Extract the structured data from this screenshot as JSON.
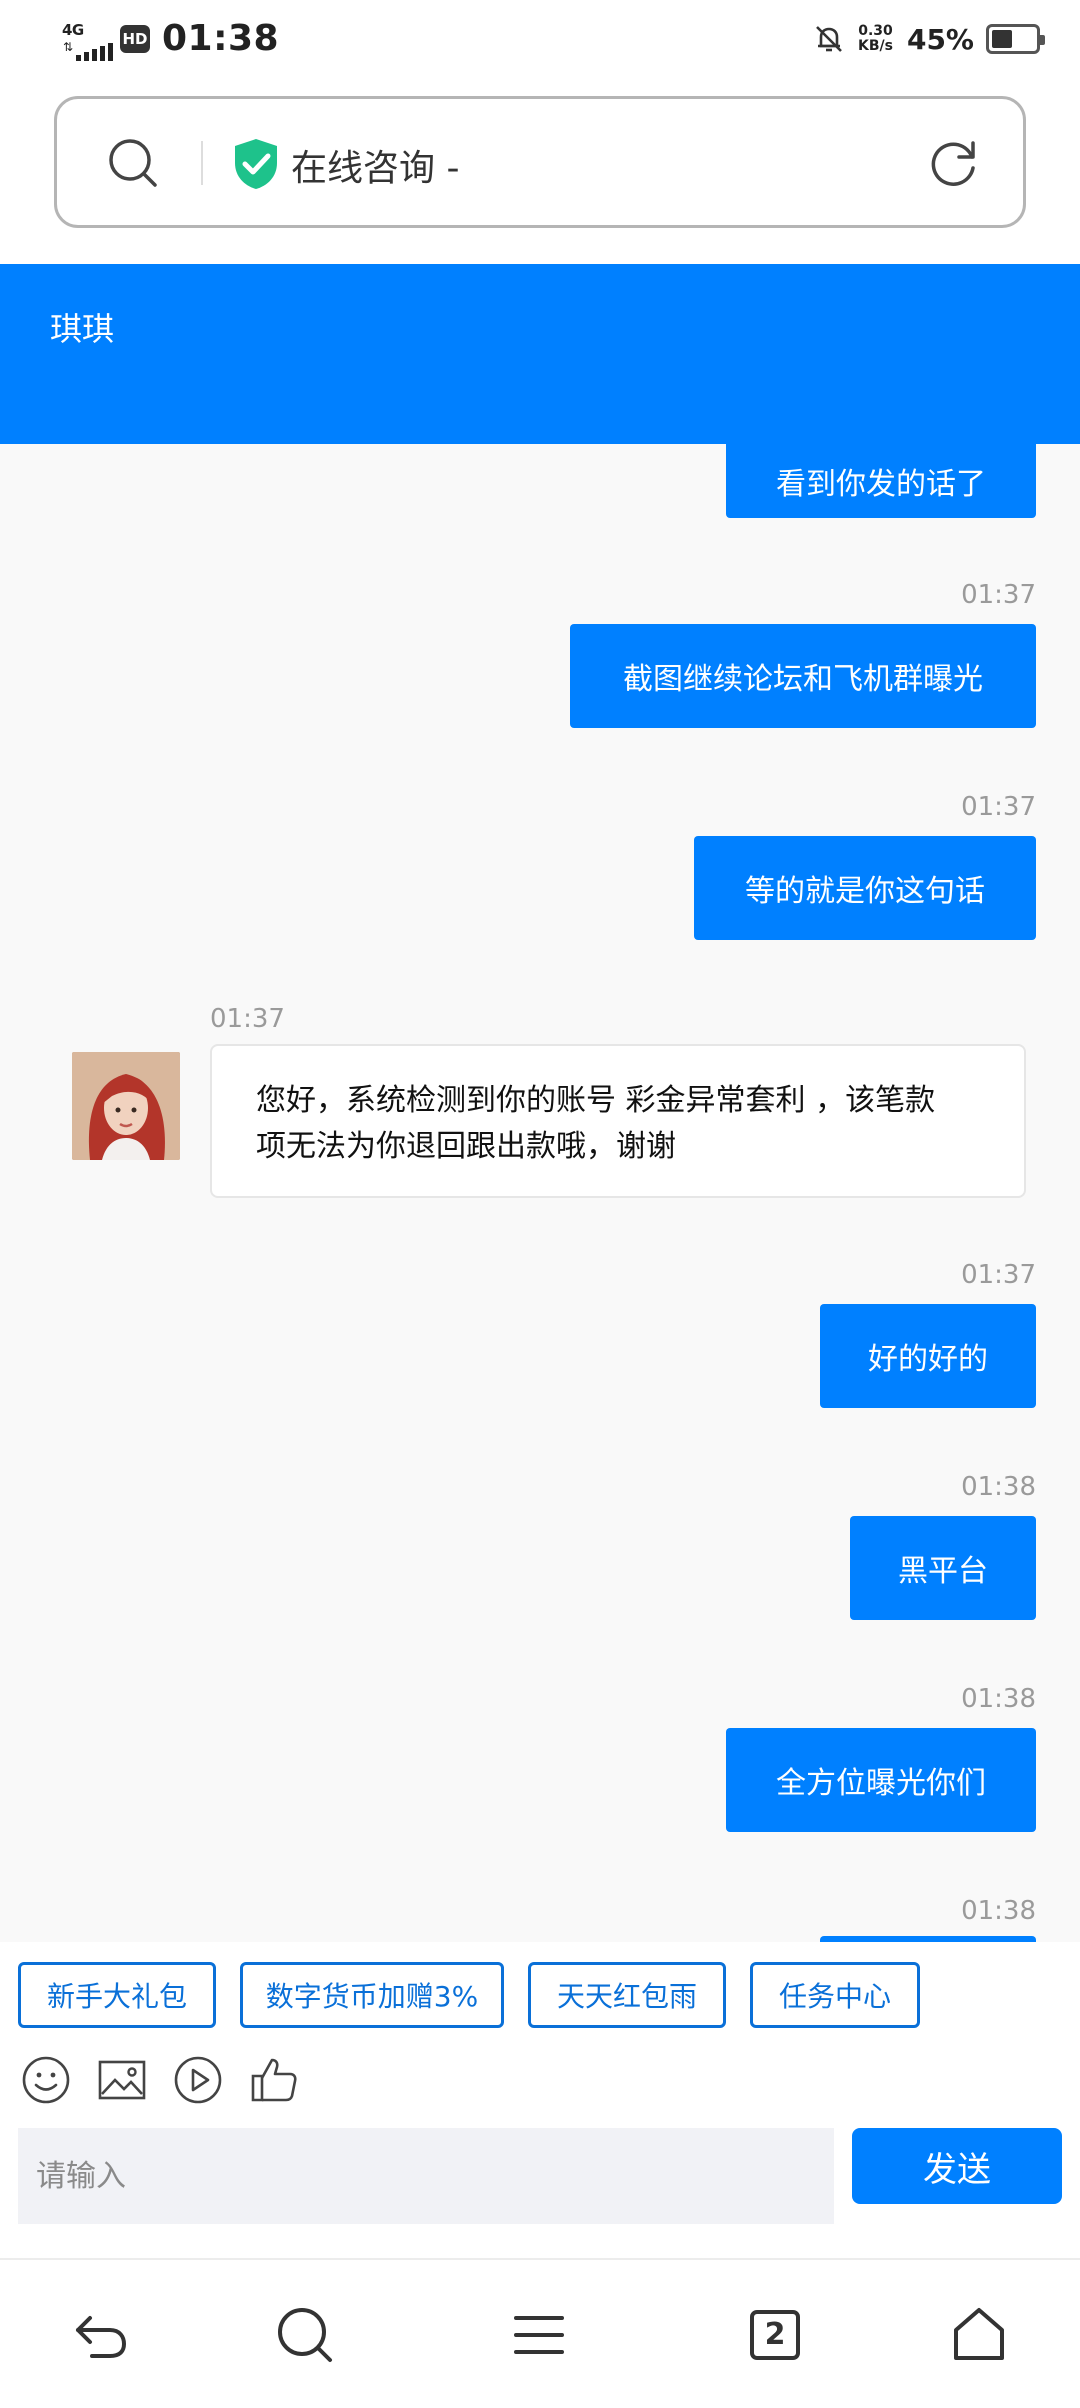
{
  "status_bar": {
    "network": "4G",
    "hd": "HD",
    "time": "01:38",
    "speed_value": "0.30",
    "speed_unit": "KB/s",
    "battery": "45%"
  },
  "address_bar": {
    "title": "在线咨询 -",
    "search_icon": "search-icon",
    "secure_icon": "shield-check-icon",
    "refresh_icon": "refresh-icon",
    "secure_color": "#1ec28b"
  },
  "chat": {
    "agent_name": "琪琪",
    "header_color": "#0080ff",
    "messages": [
      {
        "dir": "out",
        "time": "",
        "text": "看到你发的话了"
      },
      {
        "dir": "out",
        "time": "01:37",
        "text": "截图继续论坛和飞机群曝光"
      },
      {
        "dir": "out",
        "time": "01:37",
        "text": "等的就是你这句话"
      },
      {
        "dir": "in",
        "time": "01:37",
        "text_line1": "您好，系统检测到你的账号 彩金异常套利 ，该笔款",
        "text_line2": "项无法为你退回跟出款哦，谢谢"
      },
      {
        "dir": "out",
        "time": "01:37",
        "text": "好的好的"
      },
      {
        "dir": "out",
        "time": "01:38",
        "text": "黑平台"
      },
      {
        "dir": "out",
        "time": "01:38",
        "text": "全方位曝光你们"
      },
      {
        "dir": "out",
        "time": "01:38",
        "text": ""
      }
    ]
  },
  "quick_links": [
    "新手大礼包",
    "数字货币加赠3%",
    "天天红包雨",
    "任务中心"
  ],
  "tools": [
    "emoji-icon",
    "image-icon",
    "video-icon",
    "thumbs-up-icon"
  ],
  "composer": {
    "placeholder": "请输入",
    "value": "",
    "send_label": "发送"
  },
  "bottom_nav": {
    "tabs_count": "2",
    "icons": [
      "back-icon",
      "search-icon",
      "menu-icon",
      "tabs-icon",
      "home-icon"
    ]
  }
}
